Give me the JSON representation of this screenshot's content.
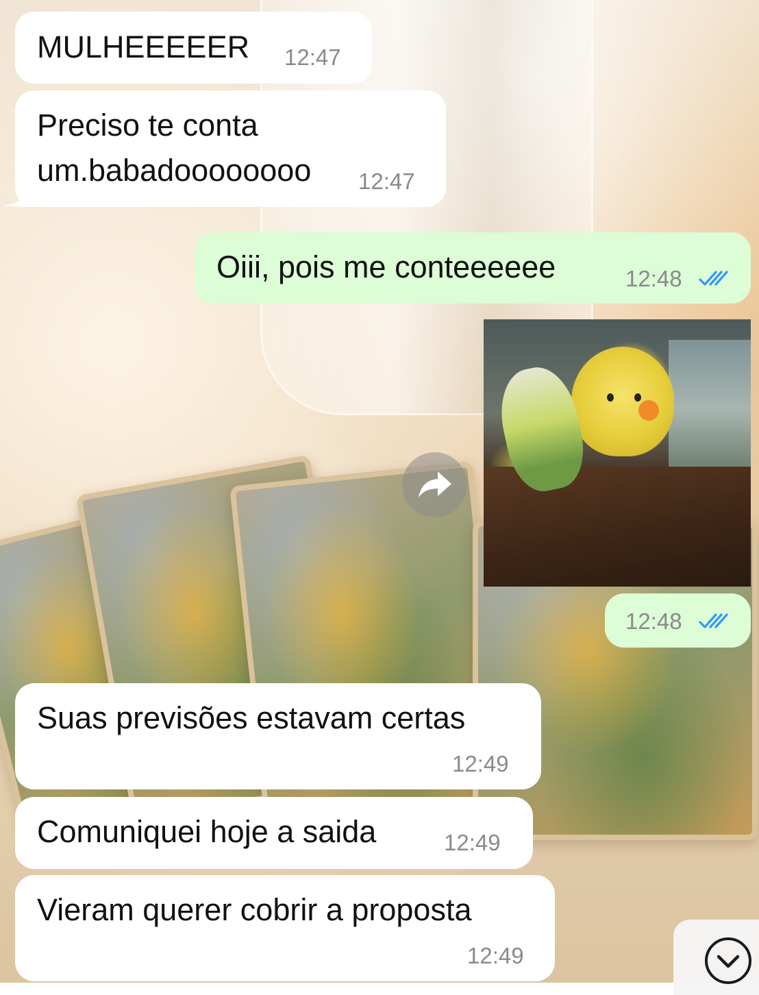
{
  "messages": [
    {
      "direction": "in",
      "text": "MULHEEEEER",
      "time": "12:47"
    },
    {
      "direction": "in",
      "text_lines": [
        "Preciso te conta",
        "um.babadoooooooo"
      ],
      "time": "12:47"
    },
    {
      "direction": "out",
      "text": "Oiii, pois me conteeeeee",
      "time": "12:48",
      "status": "read"
    },
    {
      "direction": "out",
      "type": "gif",
      "time": "12:48",
      "status": "read"
    },
    {
      "direction": "in",
      "text": "Suas previsões estavam certas",
      "time": "12:49"
    },
    {
      "direction": "in",
      "text": "Comuniquei hoje a saida",
      "time": "12:49"
    },
    {
      "direction": "in",
      "text": "Vieram querer cobrir a proposta",
      "time": "12:49"
    }
  ],
  "icons": {
    "forward": "forward-arrow-icon",
    "read_receipt": "double-check-icon",
    "scroll_down": "chevron-down-icon"
  },
  "colors": {
    "incoming_bubble": "#ffffff",
    "outgoing_bubble": "#dcfdd6",
    "read_tick": "#3497f9",
    "timestamp": "#8a8a8a"
  }
}
